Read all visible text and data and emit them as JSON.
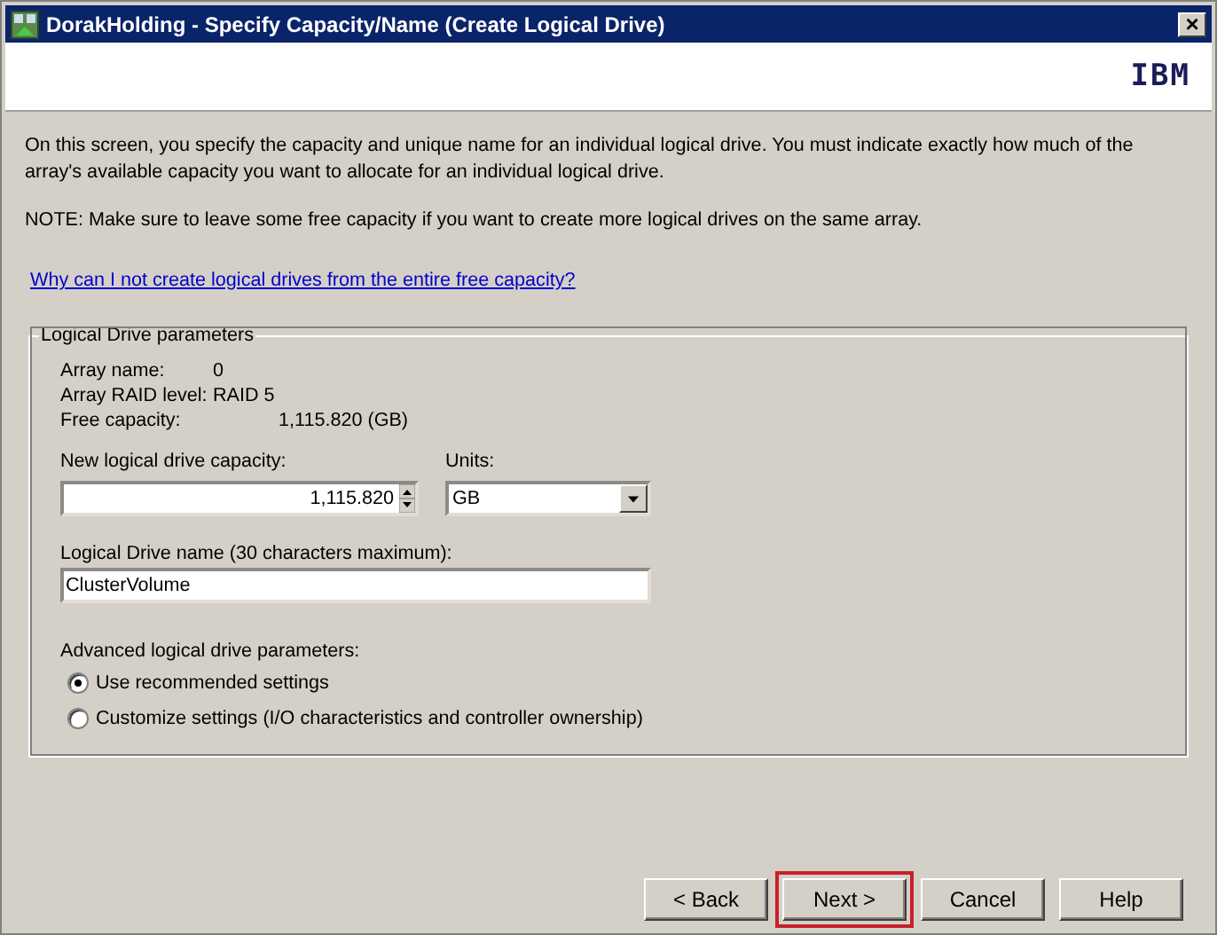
{
  "window": {
    "title": "DorakHolding - Specify Capacity/Name (Create Logical Drive)",
    "close": "×"
  },
  "banner": {
    "logo": "IBM"
  },
  "intro": "On this screen, you specify the capacity and unique name for an individual logical drive. You must indicate exactly how much of the array's available capacity you want to allocate for an individual logical drive.",
  "note": "NOTE: Make sure to leave some free capacity if you want to create more logical drives on the same array.",
  "help_link": "Why can I not create logical drives from the entire free capacity?",
  "group": {
    "legend": "Logical Drive parameters",
    "info": [
      {
        "label": "Array name:",
        "value": "0"
      },
      {
        "label": "Array RAID level:",
        "value": "RAID 5"
      },
      {
        "label": "Free capacity:",
        "value": "1,115.820 (GB)"
      }
    ],
    "capacity": {
      "label": "New logical drive capacity:",
      "value": "1,115.820"
    },
    "units": {
      "label": "Units:",
      "value": "GB"
    },
    "name": {
      "label": "Logical Drive name (30 characters maximum):",
      "value": "ClusterVolume"
    },
    "advanced": {
      "label": "Advanced logical drive parameters:",
      "options": [
        {
          "label": "Use recommended settings",
          "selected": true
        },
        {
          "label": "Customize settings (I/O characteristics and controller ownership)",
          "selected": false
        }
      ]
    }
  },
  "buttons": [
    {
      "label": "< Back",
      "highlighted": false
    },
    {
      "label": "Next >",
      "highlighted": true
    },
    {
      "label": "Cancel",
      "highlighted": false
    },
    {
      "label": "Help",
      "highlighted": false
    }
  ]
}
